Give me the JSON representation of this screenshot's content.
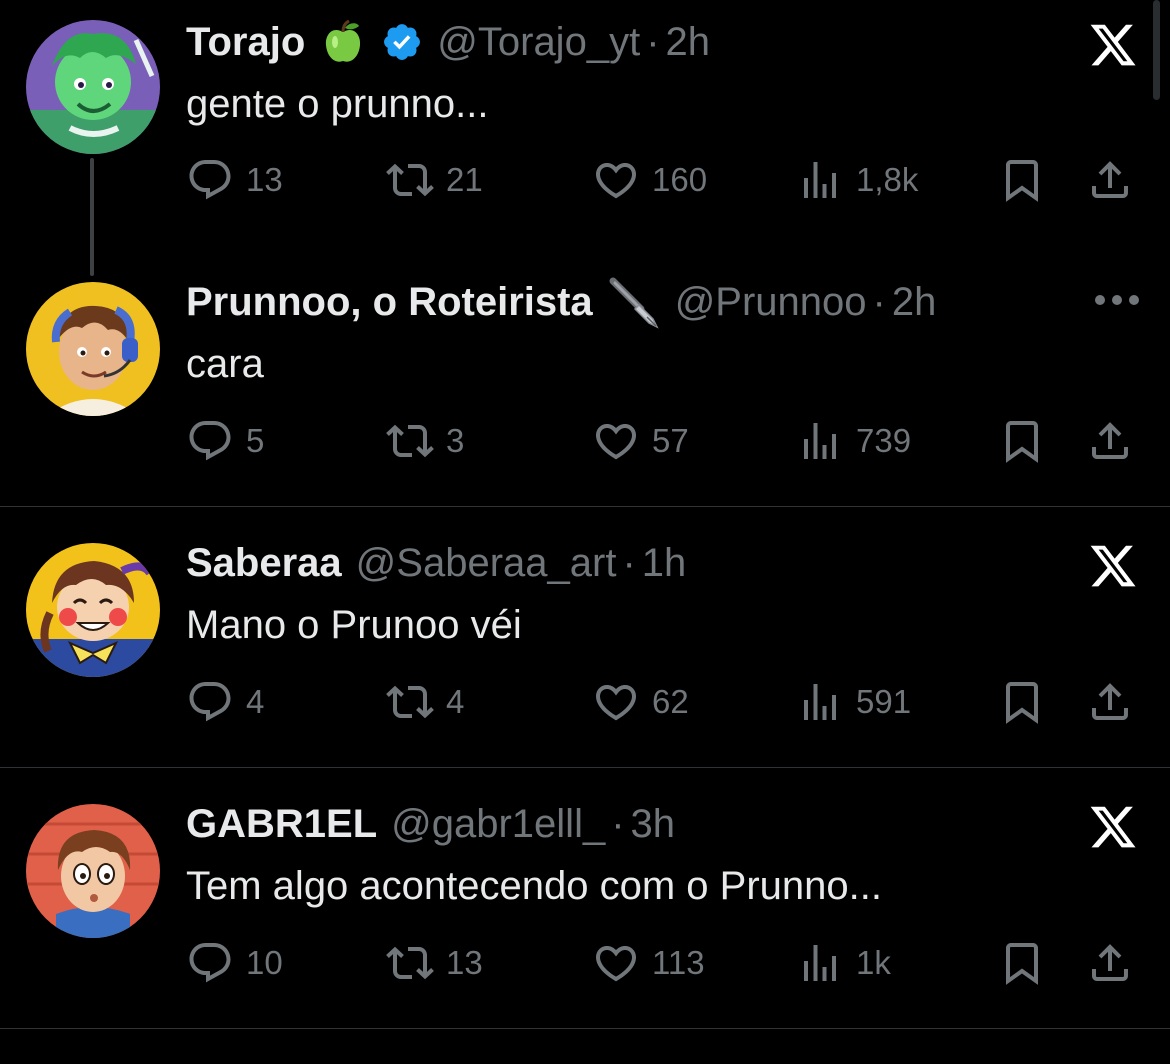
{
  "colors": {
    "background": "#000000",
    "text_primary": "#e7e9ea",
    "text_secondary": "#71767b",
    "verified": "#1d9bf0",
    "divider": "#2f3336"
  },
  "icons": {
    "reply": "reply-icon",
    "retweet": "retweet-icon",
    "like": "like-icon",
    "views": "views-icon",
    "bookmark": "bookmark-icon",
    "share": "share-icon",
    "x_logo": "x-logo-icon",
    "more": "more-icon"
  },
  "tweets": [
    {
      "name": "Torajo",
      "name_emoji": "green-apple-emoji",
      "verified": true,
      "handle": "@Torajo_yt",
      "separator": "·",
      "time": "2h",
      "text": "gente o prunno...",
      "replies": "13",
      "retweets": "21",
      "likes": "160",
      "views": "1,8k"
    },
    {
      "name": "Prunnoo, o Roteirista",
      "name_emoji": "fountain-pen-emoji",
      "verified": false,
      "handle": "@Prunnoo",
      "separator": "·",
      "time": "2h",
      "text": "cara",
      "replies": "5",
      "retweets": "3",
      "likes": "57",
      "views": "739"
    },
    {
      "name": "Saberaa",
      "verified": false,
      "handle": "@Saberaa_art",
      "separator": "·",
      "time": "1h",
      "text": "Mano o Prunoo véi",
      "replies": "4",
      "retweets": "4",
      "likes": "62",
      "views": "591"
    },
    {
      "name": "GABR1EL",
      "verified": false,
      "handle": "@gabr1elll_",
      "separator": "·",
      "time": "3h",
      "text": "Tem algo acontecendo com o Prunno...",
      "replies": "10",
      "retweets": "13",
      "likes": "113",
      "views": "1k"
    }
  ]
}
